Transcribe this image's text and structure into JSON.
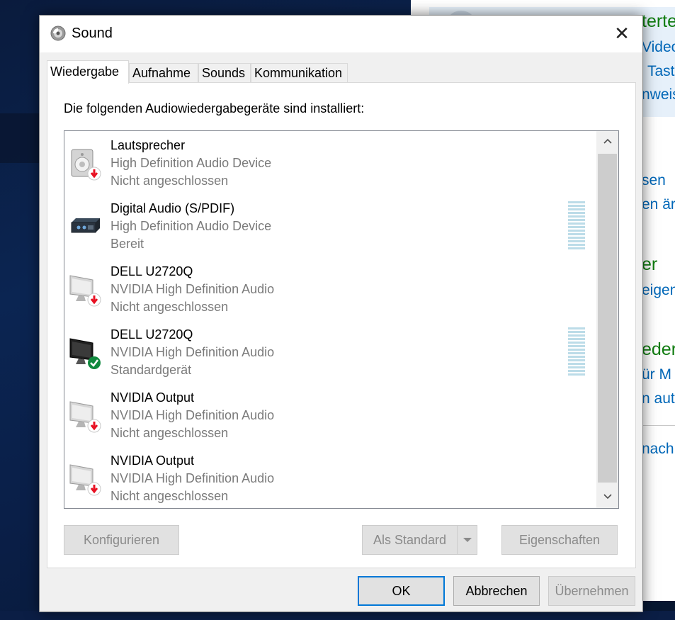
{
  "background_window": {
    "lines": [
      {
        "text": "terte",
        "style": "green"
      },
      {
        "text": "Video",
        "style": "blue"
      },
      {
        "text": "Tast",
        "style": "blue"
      },
      {
        "text": "nweis",
        "style": "blue"
      },
      {
        "text": "sen",
        "style": "blue"
      },
      {
        "text": "en är",
        "style": "blue"
      },
      {
        "text": "er",
        "style": "green"
      },
      {
        "text": "eigen",
        "style": "blue"
      },
      {
        "text": "eder",
        "style": "green"
      },
      {
        "text": "ür M",
        "style": "blue"
      },
      {
        "text": "n auto",
        "style": "blue"
      },
      {
        "text": "nach \"",
        "style": "blue"
      }
    ]
  },
  "dialog": {
    "title": "Sound",
    "title_icon": "speaker-icon",
    "close_glyph": "✕",
    "tabs": [
      {
        "label": "Wiedergabe",
        "active": true
      },
      {
        "label": "Aufnahme",
        "active": false
      },
      {
        "label": "Sounds",
        "active": false
      },
      {
        "label": "Kommunikation",
        "active": false
      }
    ],
    "intro": "Die folgenden Audiowiedergabegeräte sind installiert:",
    "devices": [
      {
        "name": "Lautsprecher",
        "driver": "High Definition Audio Device",
        "status": "Nicht angeschlossen",
        "icon": "speaker-device-icon",
        "badge": "disconnected-badge-icon"
      },
      {
        "name": "Digital Audio (S/PDIF)",
        "driver": "High Definition Audio Device",
        "status": "Bereit",
        "icon": "digital-audio-device-icon",
        "badge": "",
        "level_meter": true
      },
      {
        "name": "DELL U2720Q",
        "driver": "NVIDIA High Definition Audio",
        "status": "Nicht angeschlossen",
        "icon": "monitor-device-icon",
        "badge": "disconnected-badge-icon"
      },
      {
        "name": "DELL U2720Q",
        "driver": "NVIDIA High Definition Audio",
        "status": "Standardgerät",
        "icon": "monitor-device-icon",
        "badge": "default-check-badge-icon",
        "level_meter": true
      },
      {
        "name": "NVIDIA Output",
        "driver": "NVIDIA High Definition Audio",
        "status": "Nicht angeschlossen",
        "icon": "monitor-device-icon",
        "badge": "disconnected-badge-icon"
      },
      {
        "name": "NVIDIA Output",
        "driver": "NVIDIA High Definition Audio",
        "status": "Nicht angeschlossen",
        "icon": "monitor-device-icon",
        "badge": "disconnected-badge-icon"
      }
    ],
    "buttons": {
      "configure": "Konfigurieren",
      "set_default": "Als Standard",
      "properties": "Eigenschaften",
      "ok": "OK",
      "cancel": "Abbrechen",
      "apply": "Übernehmen"
    },
    "colors": {
      "accent": "#0078d7",
      "disconnected": "#e81123",
      "default_ok": "#10893e",
      "level_meter": "#bcdce8"
    }
  }
}
